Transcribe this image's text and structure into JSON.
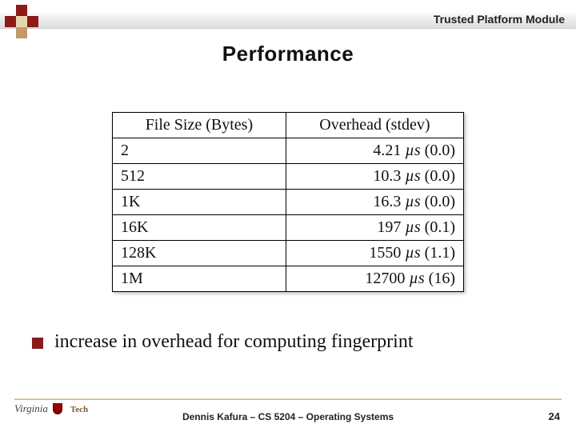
{
  "header": {
    "topic": "Trusted Platform Module",
    "title": "Performance"
  },
  "table": {
    "headers": {
      "col1": "File Size (Bytes)",
      "col2": "Overhead (stdev)"
    },
    "rows": [
      {
        "size": "2",
        "val": "4.21",
        "unit": "µs",
        "stdev": "(0.0)"
      },
      {
        "size": "512",
        "val": "10.3",
        "unit": "µs",
        "stdev": "(0.0)"
      },
      {
        "size": "1K",
        "val": "16.3",
        "unit": "µs",
        "stdev": "(0.0)"
      },
      {
        "size": "16K",
        "val": "197",
        "unit": "µs",
        "stdev": "(0.1)"
      },
      {
        "size": "128K",
        "val": "1550",
        "unit": "µs",
        "stdev": "(1.1)"
      },
      {
        "size": "1M",
        "val": "12700",
        "unit": "µs",
        "stdev": "(16)"
      }
    ]
  },
  "bullet": {
    "text": "increase in overhead for computing fingerprint"
  },
  "footer": {
    "center": "Dennis Kafura – CS 5204 – Operating Systems",
    "page": "24",
    "logo_v": "Virginia",
    "logo_t": "Tech"
  },
  "chart_data": {
    "type": "table",
    "title": "Performance",
    "columns": [
      "File Size (Bytes)",
      "Overhead (stdev)"
    ],
    "rows": [
      [
        "2",
        "4.21 µs (0.0)"
      ],
      [
        "512",
        "10.3 µs (0.0)"
      ],
      [
        "1K",
        "16.3 µs (0.0)"
      ],
      [
        "16K",
        "197 µs (0.1)"
      ],
      [
        "128K",
        "1550 µs (1.1)"
      ],
      [
        "1M",
        "12700 µs (16)"
      ]
    ]
  }
}
